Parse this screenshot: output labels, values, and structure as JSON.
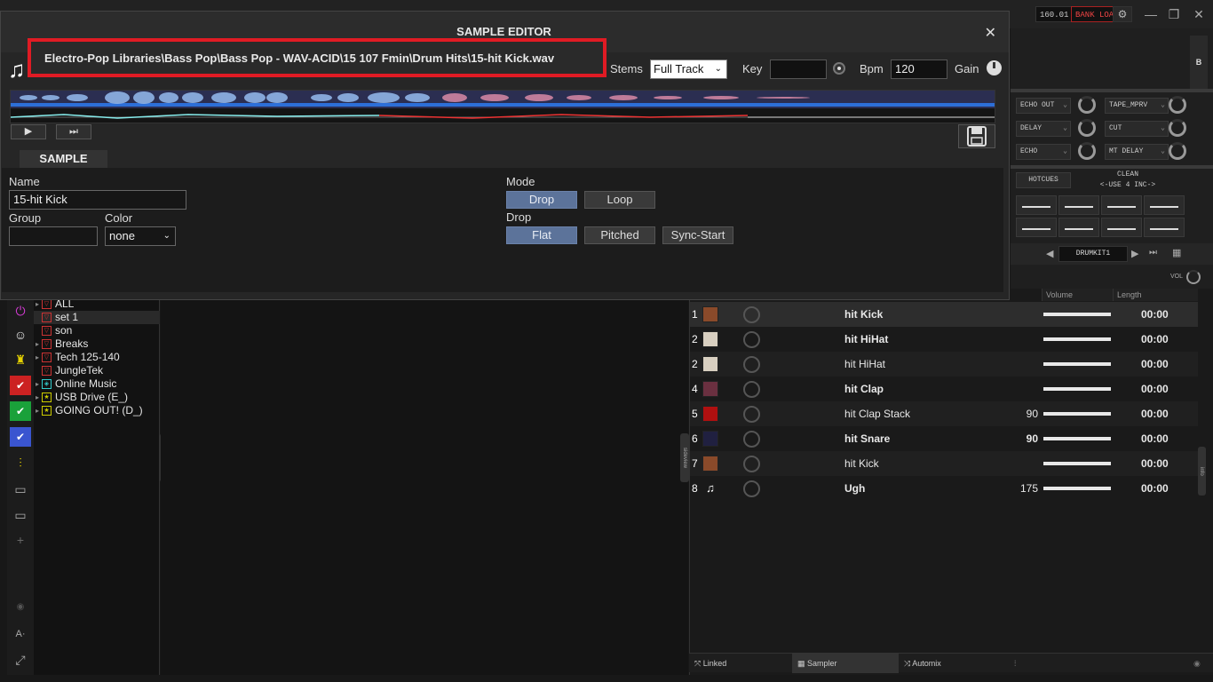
{
  "colors": {
    "highlight_box": "#e01b24",
    "active_mode": "#5c739a",
    "background": "#181818"
  },
  "topbar": {
    "bpm_readout": "160.01",
    "bank_load": "BANK LOAD"
  },
  "deck": {
    "deck_letter": "B",
    "fx_left": [
      "ECHO OUT",
      "DELAY",
      "ECHO"
    ],
    "fx_right": [
      "TAPE_MPRV",
      "CUT",
      "MT DELAY"
    ],
    "hotcues": "HOTCUES",
    "clean": "CLEAN",
    "use_inc": "<-USE 4 INC->",
    "drumkit": "DRUMKIT1",
    "vol": "VOL"
  },
  "tree": {
    "items": [
      {
        "label": "ALL",
        "icon": "folder-icon"
      },
      {
        "label": "set 1",
        "icon": "folder-icon",
        "selected": true
      },
      {
        "label": "son",
        "icon": "folder-icon"
      },
      {
        "label": "Breaks",
        "icon": "folder-icon"
      },
      {
        "label": "Tech 125-140",
        "icon": "folder-icon"
      },
      {
        "label": "JungleTek",
        "icon": "folder-icon"
      },
      {
        "label": "Online Music",
        "icon": "cloud-icon"
      },
      {
        "label": "USB Drive (E_)",
        "icon": "star-icon"
      },
      {
        "label": "GOING OUT! (D_)",
        "icon": "star-icon"
      }
    ],
    "folders_tab": "folders"
  },
  "sampler": {
    "columns": {
      "volume": "Volume",
      "length": "Length"
    },
    "sidetab": "sideview",
    "infotab": "info",
    "rows": [
      {
        "num": "1",
        "name": "hit Kick",
        "bpm": "",
        "length": "00:00",
        "bold": true
      },
      {
        "num": "2",
        "name": "hit HiHat",
        "bpm": "",
        "length": "00:00",
        "bold": true
      },
      {
        "num": "2",
        "name": "hit HiHat",
        "bpm": "",
        "length": "00:00",
        "bold": false
      },
      {
        "num": "4",
        "name": "hit Clap",
        "bpm": "",
        "length": "00:00",
        "bold": true
      },
      {
        "num": "5",
        "name": "hit Clap Stack",
        "bpm": "90",
        "length": "00:00",
        "bold": false
      },
      {
        "num": "6",
        "name": "hit Snare",
        "bpm": "90",
        "length": "00:00",
        "bold": true
      },
      {
        "num": "7",
        "name": "hit Kick",
        "bpm": "",
        "length": "00:00",
        "bold": false
      },
      {
        "num": "8",
        "name": "Ugh",
        "bpm": "175",
        "length": "00:00",
        "bold": true
      }
    ]
  },
  "bottombar": {
    "linked": "Linked",
    "sampler": "Sampler",
    "automix": "Automix"
  },
  "editor": {
    "title": "SAMPLE EDITOR",
    "path": "Electro-Pop Libraries\\Bass Pop\\Bass Pop - WAV-ACID\\15 107 Fmin\\Drum Hits\\15-hit Kick.wav",
    "stems_label": "Stems",
    "stems_value": "Full Track",
    "key_label": "Key",
    "key_value": "",
    "bpm_label": "Bpm",
    "bpm_value": "120",
    "gain_label": "Gain",
    "sample_tab": "SAMPLE",
    "name_label": "Name",
    "name_value": "15-hit Kick",
    "group_label": "Group",
    "group_value": "",
    "color_label": "Color",
    "color_value": "none",
    "mode_label": "Mode",
    "mode_drop": "Drop",
    "mode_loop": "Loop",
    "drop_label": "Drop",
    "drop_flat": "Flat",
    "drop_pitched": "Pitched",
    "drop_sync": "Sync-Start"
  }
}
